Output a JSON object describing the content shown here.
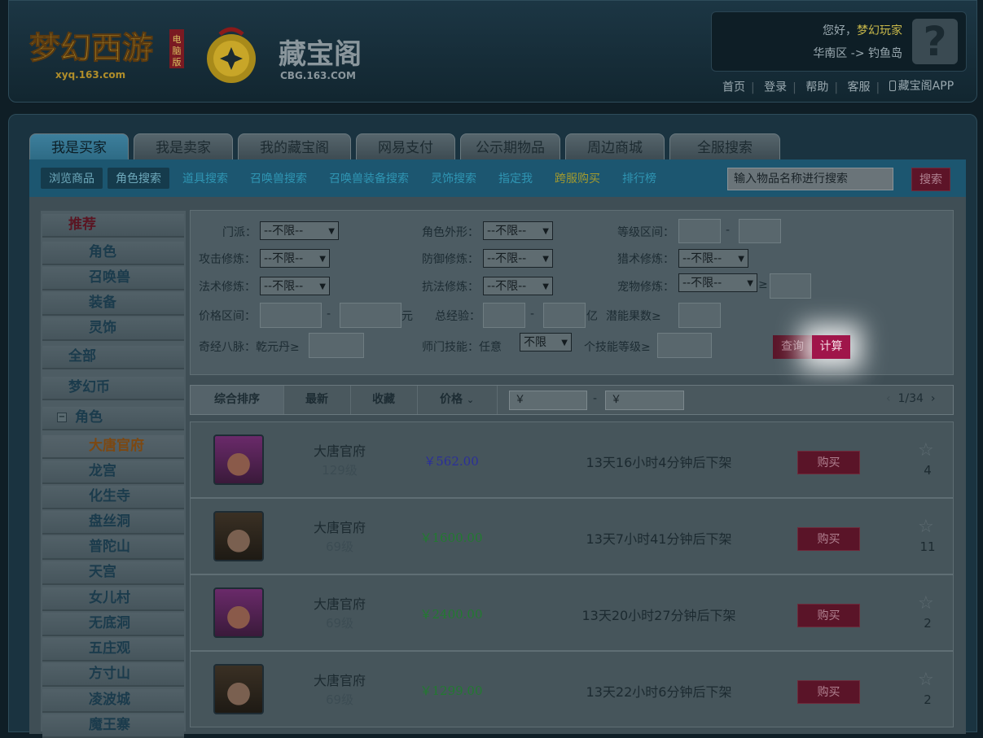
{
  "header": {
    "game_logo_text": "梦幻西游 电脑版 xyq.163.com",
    "cbg_logo_text": "藏宝阁",
    "cbg_logo_sub": "CBG.163.COM",
    "greeting": "您好，",
    "username": "梦幻玩家",
    "region": "华南区 -> 钓鱼岛",
    "links": [
      "首页",
      "登录",
      "帮助",
      "客服",
      "藏宝阁APP"
    ]
  },
  "tabs": [
    "我是买家",
    "我是卖家",
    "我的藏宝阁",
    "网易支付",
    "公示期物品",
    "周边商城",
    "全服搜索"
  ],
  "subnav": {
    "items": [
      "浏览商品",
      "角色搜索",
      "道具搜索",
      "召唤兽搜索",
      "召唤兽装备搜索",
      "灵饰搜索",
      "指定我",
      "跨服购买",
      "排行榜"
    ],
    "search_placeholder": "输入物品名称进行搜索",
    "search_button": "搜索"
  },
  "sidebar": {
    "recommend": "推荐",
    "recommend_items": [
      "角色",
      "召唤兽",
      "装备",
      "灵饰"
    ],
    "all": "全部",
    "currency": "梦幻币",
    "role": "角色",
    "schools": [
      "大唐官府",
      "龙宫",
      "化生寺",
      "盘丝洞",
      "普陀山",
      "天宫",
      "女儿村",
      "无底洞",
      "五庄观",
      "方寸山",
      "凌波城",
      "魔王寨"
    ]
  },
  "filter": {
    "school_label": "门派：",
    "appearance_label": "角色外形：",
    "level_label": "等级区间：",
    "attack_label": "攻击修炼：",
    "defense_label": "防御修炼：",
    "hunt_label": "猎术修炼：",
    "magic_label": "法术修炼：",
    "resist_label": "抗法修炼：",
    "pet_label": "宠物修炼：",
    "price_label": "价格区间：",
    "exp_label": "总经验：",
    "potential_label": "潜能果数≥",
    "meridian_label": "奇经八脉：乾元丹≥",
    "skill_label": "师门技能：任意",
    "skill_level_label": "个技能等级≥",
    "unlimited": "--不限--",
    "unlimited_short": "不限",
    "dash": "-",
    "gte": "≥",
    "yuan": "元",
    "yi": "亿",
    "query_button": "查询",
    "calc_button": "计算"
  },
  "sort": {
    "items": [
      "综合排序",
      "最新",
      "收藏",
      "价格"
    ],
    "price_low": "￥",
    "price_high": "￥",
    "dash": "-",
    "pager": "1/34"
  },
  "listings": [
    {
      "name": "大唐官府",
      "level": "129级",
      "price": "￥562.00",
      "price_color": "#2b2f9a",
      "time": "13天16小时4分钟后下架",
      "buy": "购买",
      "fav": "4"
    },
    {
      "name": "大唐官府",
      "level": "69级",
      "price": "￥1600.00",
      "price_color": "#227a30",
      "time": "13天7小时41分钟后下架",
      "buy": "购买",
      "fav": "11"
    },
    {
      "name": "大唐官府",
      "level": "69级",
      "price": "￥2400.00",
      "price_color": "#227a30",
      "time": "13天20小时27分钟后下架",
      "buy": "购买",
      "fav": "2"
    },
    {
      "name": "大唐官府",
      "level": "69级",
      "price": "￥1299.00",
      "price_color": "#227a30",
      "time": "13天22小时6分钟后下架",
      "buy": "购买",
      "fav": "2"
    }
  ]
}
